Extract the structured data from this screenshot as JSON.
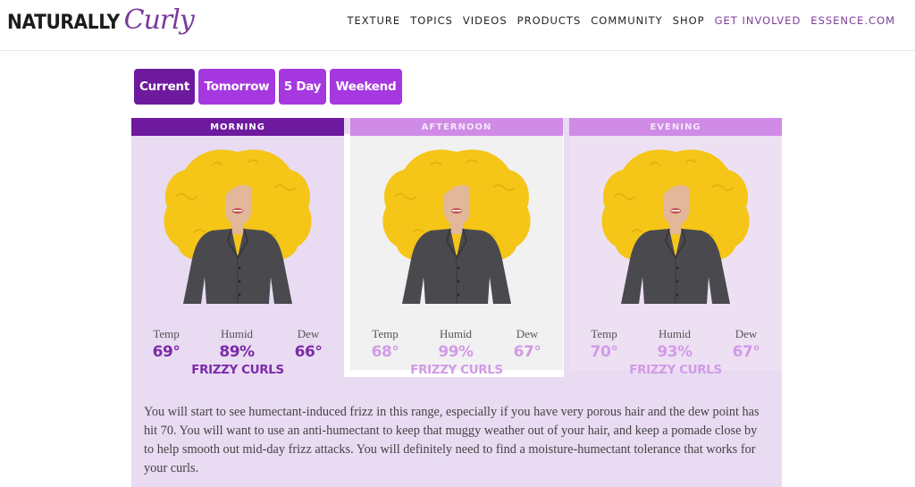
{
  "header": {
    "logo": {
      "part1": "NATURALLY",
      "part2": "Curly"
    },
    "nav": [
      {
        "label": "TEXTURE",
        "accent": false
      },
      {
        "label": "TOPICS",
        "accent": false
      },
      {
        "label": "VIDEOS",
        "accent": false
      },
      {
        "label": "PRODUCTS",
        "accent": false
      },
      {
        "label": "COMMUNITY",
        "accent": false
      },
      {
        "label": "SHOP",
        "accent": false
      },
      {
        "label": "GET INVOLVED",
        "accent": true
      },
      {
        "label": "ESSENCE.COM",
        "accent": true
      }
    ]
  },
  "tabs": [
    {
      "label": "Current",
      "active": true
    },
    {
      "label": "Tomorrow",
      "active": false
    },
    {
      "label": "5 Day",
      "active": false
    },
    {
      "label": "Weekend",
      "active": false
    }
  ],
  "forecast": [
    {
      "period": "MORNING",
      "temp_label": "Temp",
      "temp": "69°",
      "humid_label": "Humid",
      "humid": "89%",
      "dew_label": "Dew",
      "dew": "66°",
      "condition": "FRIZZY CURLS",
      "selected": true
    },
    {
      "period": "AFTERNOON",
      "temp_label": "Temp",
      "temp": "68°",
      "humid_label": "Humid",
      "humid": "99%",
      "dew_label": "Dew",
      "dew": "67°",
      "condition": "FRIZZY CURLS",
      "selected": false
    },
    {
      "period": "EVENING",
      "temp_label": "Temp",
      "temp": "70°",
      "humid_label": "Humid",
      "humid": "93%",
      "dew_label": "Dew",
      "dew": "67°",
      "condition": "FRIZZY CURLS",
      "selected": false
    }
  ],
  "description": "You will start to see humectant-induced frizz in this range, especially if you have very porous hair and the dew point has hit 70. You will want to use an anti-humectant to keep that muggy weather out of your hair, and keep a pomade close by to help smooth out mid-day frizz attacks. You will definitely need to find a moisture-humectant tolerance that works for your curls.",
  "colors": {
    "brand_purple": "#7d3c98",
    "tab_active": "#6e1a9e",
    "tab_inactive": "#a638e0",
    "header_muted": "#d08be6",
    "panel_bg": "#e8dbf2",
    "hair": "#f5c518",
    "shirt": "#4a4a4e",
    "skin": "#e2b79a"
  }
}
